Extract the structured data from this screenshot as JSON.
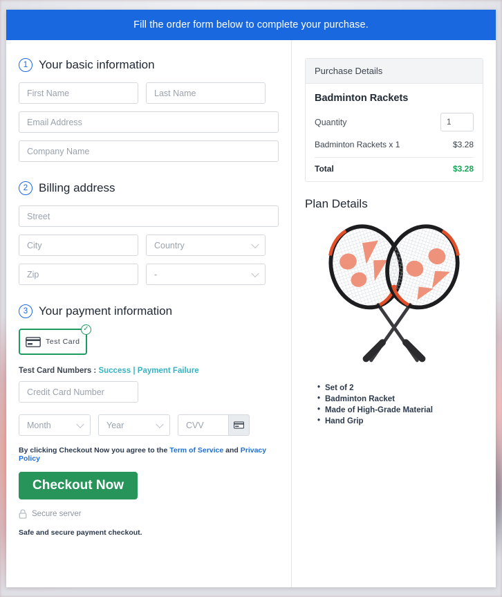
{
  "banner": {
    "text": "Fill the order form below to complete your purchase."
  },
  "steps": [
    {
      "num": "1",
      "title": "Your basic information"
    },
    {
      "num": "2",
      "title": "Billing address"
    },
    {
      "num": "3",
      "title": "Your payment information"
    }
  ],
  "basic_info": {
    "first_name_placeholder": "First Name",
    "last_name_placeholder": "Last Name",
    "email_placeholder": "Email Address",
    "company_placeholder": "Company Name"
  },
  "billing": {
    "street_placeholder": "Street",
    "city_placeholder": "City",
    "country_placeholder": "Country",
    "zip_placeholder": "Zip",
    "state_placeholder": "-"
  },
  "payment": {
    "card_tile_label": "Test  Card",
    "card_tile_icon": "credit-card-icon",
    "card_tile_check": "✓",
    "test_cards_prefix": "Test Card Numbers :",
    "test_card_success": "Success",
    "test_card_separator": "|",
    "test_card_failure": "Payment Failure",
    "credit_card_placeholder": "Credit Card Number",
    "month_placeholder": "Month",
    "year_placeholder": "Year",
    "cvv_placeholder": "CVV",
    "cvv_icon": "credit-card-icon"
  },
  "footer": {
    "terms_prefix": "By clicking Checkout Now you agree to the",
    "terms_link": "Term of Service",
    "terms_and": "and",
    "privacy_link": "Privacy Policy",
    "checkout_label": "Checkout Now",
    "secure_icon": "lock-icon",
    "secure_label": "Secure server",
    "safe_note": "Safe and secure payment checkout."
  },
  "purchase": {
    "panel_title": "Purchase Details",
    "product_name": "Badminton Rackets",
    "quantity_label": "Quantity",
    "quantity_value": "1",
    "line_item_label": "Badminton Rackets x 1",
    "line_item_amount": "$3.28",
    "total_label": "Total",
    "total_amount": "$3.28"
  },
  "plan": {
    "title": "Plan Details",
    "image_alt": "badminton-rackets-image",
    "features": [
      "Set of 2",
      "Badminton Racket",
      "Made of High-Grade Material",
      "Hand Grip"
    ]
  },
  "colors": {
    "banner_blue": "#1a68e0",
    "accent_green": "#279559",
    "total_green": "#18a558",
    "link_teal": "#36b3c4",
    "link_blue": "#1f6fd4"
  }
}
